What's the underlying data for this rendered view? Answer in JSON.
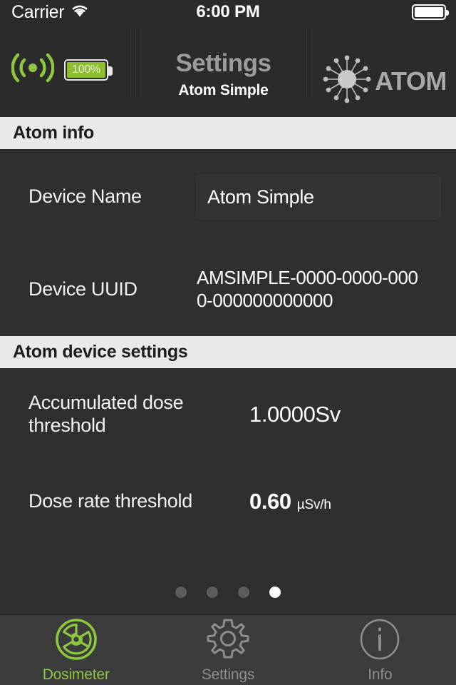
{
  "status_bar": {
    "carrier": "Carrier",
    "wifi_icon": "wifi-icon",
    "time": "6:00 PM",
    "battery_icon": "battery-full-icon"
  },
  "header": {
    "signal_icon": "signal-wave-icon",
    "device_battery": {
      "label": "100%",
      "percent": 100,
      "color": "#8dbe2b"
    },
    "title": "Settings",
    "subtitle": "Atom Simple",
    "brand": {
      "logo_icon": "atom-burst-icon",
      "text": "ATOM"
    }
  },
  "sections": [
    {
      "id": "atom-info",
      "title": "Atom info",
      "rows": [
        {
          "id": "device-name",
          "label": "Device Name",
          "value": "Atom Simple",
          "placeholder": "Device Name"
        },
        {
          "id": "device-uuid",
          "label": "Device UUID",
          "value": "AMSIMPLE-0000-0000-0000-000000000000"
        }
      ]
    },
    {
      "id": "atom-device-settings",
      "title": "Atom device settings",
      "rows": [
        {
          "id": "accumulated-dose-threshold",
          "label": "Accumulated dose threshold",
          "value": "1.0000Sv"
        },
        {
          "id": "dose-rate-threshold",
          "label": "Dose rate threshold",
          "value": "0.60",
          "unit": "µSv/h"
        }
      ]
    }
  ],
  "pager": {
    "total": 4,
    "active_index": 3
  },
  "tabbar": {
    "items": [
      {
        "id": "dosimeter",
        "label": "Dosimeter",
        "icon": "radiation-trefoil-icon",
        "active": true
      },
      {
        "id": "settings",
        "label": "Settings",
        "icon": "gear-icon",
        "active": false
      },
      {
        "id": "info",
        "label": "Info",
        "icon": "info-circle-icon",
        "active": false
      }
    ]
  },
  "colors": {
    "accent_green": "#8dc63f",
    "battery_green": "#8dbe2b",
    "background": "#2f2f2f",
    "header_bg": "#2b2b2b",
    "section_header_bg": "#e9e9e9",
    "tabbar_bg": "#3c3c3c",
    "inactive_gray": "#8d8d8d"
  }
}
